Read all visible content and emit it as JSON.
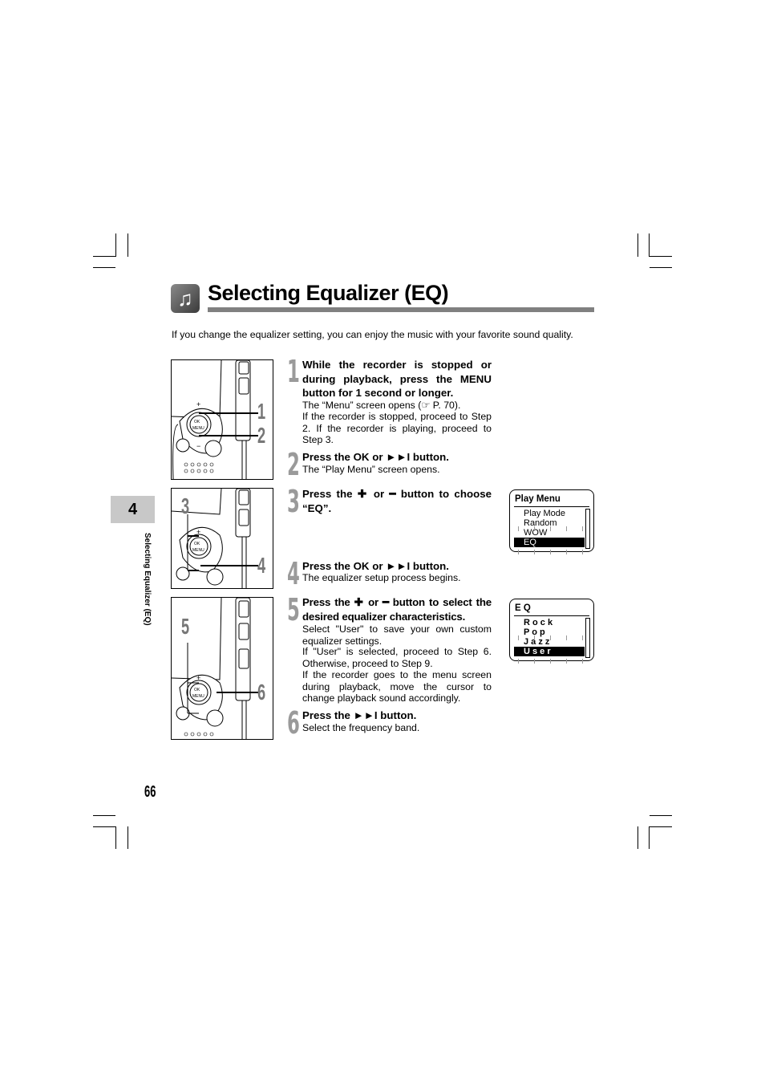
{
  "header": {
    "title": "Selecting Equalizer (EQ)",
    "icon": "music-notes-icon",
    "intro": "If you change the equalizer setting, you can enjoy the music with your favorite sound quality."
  },
  "side_tab": {
    "chapter": "4",
    "label": "Selecting Equalizer (EQ)"
  },
  "page_number": "66",
  "figures": [
    {
      "callouts": [
        "1",
        "2"
      ]
    },
    {
      "callouts": [
        "3",
        "4"
      ]
    },
    {
      "callouts": [
        "5",
        "6"
      ]
    }
  ],
  "steps": [
    {
      "num": "1",
      "head": "While the recorder is stopped or during playback, press the MENU button for 1 second or longer.",
      "body": [
        "The “Menu” screen opens (☞ P. 70).",
        "If the recorder is stopped, proceed to Step 2. If the recorder is playing, proceed to Step 3."
      ]
    },
    {
      "num": "2",
      "head": "Press the OK or ►►I button.",
      "body": [
        "The “Play Menu” screen opens."
      ]
    },
    {
      "num": "3",
      "head": "Press the ✚ or ━ button to choose “EQ”.",
      "body": []
    },
    {
      "num": "4",
      "head": "Press the OK or ►►I button.",
      "body": [
        "The equalizer setup process begins."
      ]
    },
    {
      "num": "5",
      "head": "Press the ✚ or ━ button to select the desired equalizer characteristics.",
      "body": [
        "Select \"User\" to save your own custom equalizer settings.",
        "If \"User\" is selected, proceed to Step 6. Otherwise, proceed to Step 9.",
        "If the recorder goes to the menu screen during playback, move the cursor to change playback sound accordingly."
      ]
    },
    {
      "num": "6",
      "head": "Press the ►►I button.",
      "body": [
        "Select the frequency band."
      ]
    }
  ],
  "screens": {
    "play_menu": {
      "title": "Play Menu",
      "items": [
        "Play Mode",
        "Random",
        "WOW",
        "EQ"
      ],
      "selected": "EQ"
    },
    "eq": {
      "title": "E Q",
      "items": [
        "R o c k",
        "P o p",
        "J a z z",
        "U s e r"
      ],
      "selected": "U s e r"
    }
  }
}
